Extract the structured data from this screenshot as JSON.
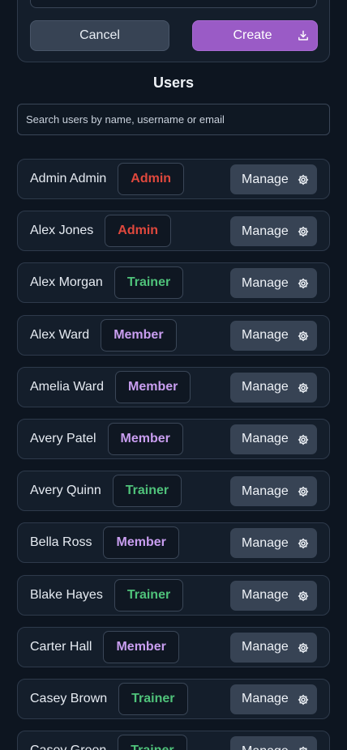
{
  "create_form": {
    "cancel_label": "Cancel",
    "create_label": "Create",
    "create_icon": "download-icon"
  },
  "users_section": {
    "title": "Users",
    "search_placeholder": "Search users by name, username or email"
  },
  "colors": {
    "admin": "#e0483d",
    "trainer": "#4fc27a",
    "member": "#c99ef0",
    "create_button": "#9a5bc6"
  },
  "users": [
    {
      "name": "Admin Admin",
      "role": "Admin",
      "action": "Manage"
    },
    {
      "name": "Alex Jones",
      "role": "Admin",
      "action": "Manage"
    },
    {
      "name": "Alex Morgan",
      "role": "Trainer",
      "action": "Manage"
    },
    {
      "name": "Alex Ward",
      "role": "Member",
      "action": "Manage"
    },
    {
      "name": "Amelia Ward",
      "role": "Member",
      "action": "Manage"
    },
    {
      "name": "Avery Patel",
      "role": "Member",
      "action": "Manage"
    },
    {
      "name": "Avery Quinn",
      "role": "Trainer",
      "action": "Manage"
    },
    {
      "name": "Bella Ross",
      "role": "Member",
      "action": "Manage"
    },
    {
      "name": "Blake Hayes",
      "role": "Trainer",
      "action": "Manage"
    },
    {
      "name": "Carter Hall",
      "role": "Member",
      "action": "Manage"
    },
    {
      "name": "Casey Brown",
      "role": "Trainer",
      "action": "Manage"
    },
    {
      "name": "Casey Green",
      "role": "Trainer",
      "action": "Manage"
    }
  ]
}
